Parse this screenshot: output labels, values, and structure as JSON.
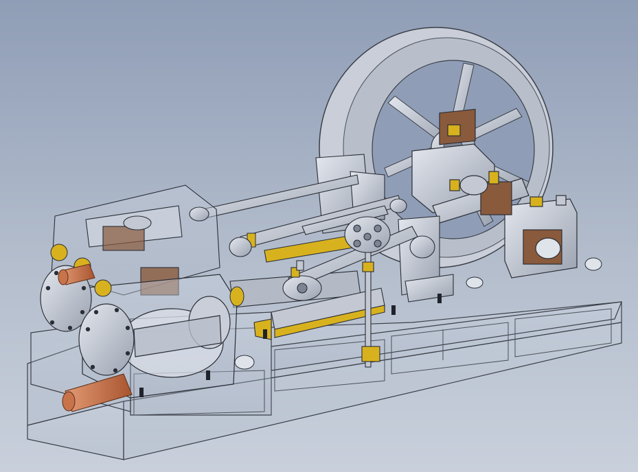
{
  "scene": {
    "subject": "steam-engine-cad-model",
    "view": "isometric",
    "render_style": "transparent-wireframe-shaded",
    "colors": {
      "background_top": "#8f9db6",
      "background_bottom": "#c9d0dc",
      "steel": "#c3c8d2",
      "steel_dark": "#7d8594",
      "brass": "#d8b21e",
      "copper": "#c9734a",
      "bronze_pad": "#8a5a3c",
      "edge": "#2a2e36"
    }
  }
}
